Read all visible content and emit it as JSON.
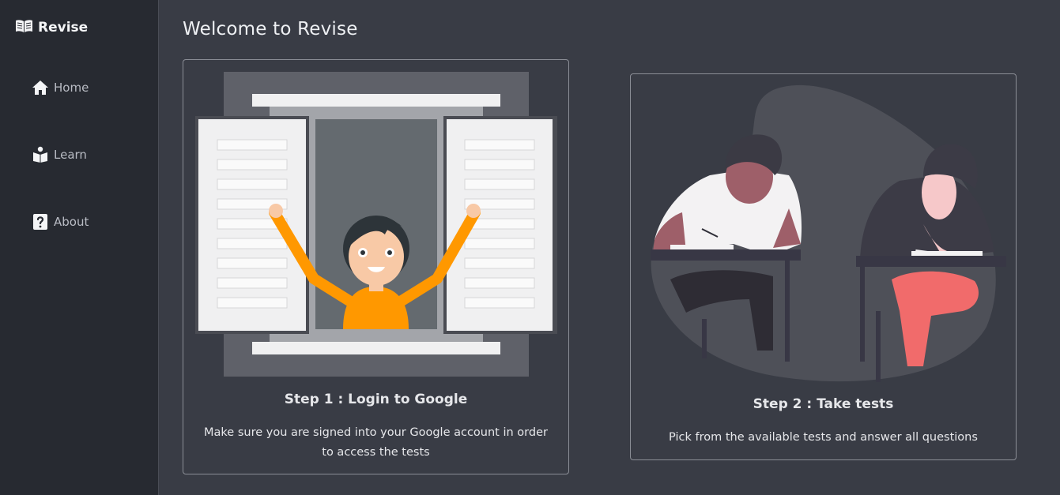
{
  "sidebar": {
    "brand": "Revise",
    "items": [
      {
        "label": "Home",
        "icon": "home-icon"
      },
      {
        "label": "Learn",
        "icon": "reader-icon"
      },
      {
        "label": "About",
        "icon": "question-icon"
      }
    ]
  },
  "main": {
    "title": "Welcome to Revise",
    "steps": [
      {
        "title": "Step 1 : Login to Google",
        "text": "Make sure you are signed into your Google account in order to access the tests",
        "illustration": "person-waving-from-window-illustration"
      },
      {
        "title": "Step 2 : Take tests",
        "text": "Pick from the available tests and answer all questions",
        "illustration": "students-taking-exam-illustration"
      }
    ]
  },
  "colors": {
    "sidebar_bg": "#272a31",
    "main_bg": "#393c45",
    "card_border": "#8b8e96",
    "accent_orange": "#ff9800",
    "accent_red": "#f16b6b"
  }
}
